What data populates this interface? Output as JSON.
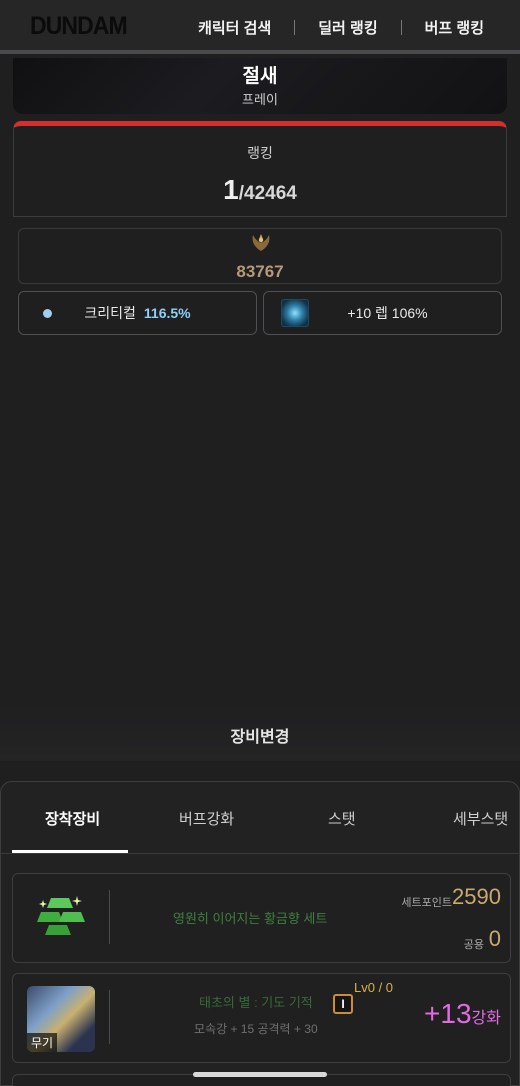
{
  "header": {
    "logo": "DUNDAM",
    "nav": [
      "캐릭터 검색",
      "딜러 랭킹",
      "버프 랭킹"
    ]
  },
  "character": {
    "name": "절새",
    "job": "프레이"
  },
  "ranking": {
    "label": "랭킹",
    "rank": "1",
    "total": "/42464"
  },
  "score": {
    "value": "83767",
    "emblem_icon": "laurel-emblem-icon"
  },
  "stats": {
    "crit_label": "크리티컬",
    "crit_value": "116.5%",
    "level_text": "+10 렙 106%",
    "level_icon": "skill-icon"
  },
  "change_equipment": "장비변경",
  "tabs": [
    "장착장비",
    "버프강화",
    "스탯",
    "세부스탯"
  ],
  "set_item": {
    "name": "영원히 이어지는 황금향 세트",
    "set_point_label": "세트포인트",
    "set_point_value": "2590",
    "common_label": "공용",
    "common_value": "0",
    "icon": "gold-bars-icon"
  },
  "weapon": {
    "tag": "무기",
    "name": "태초의 별 : 기도 기적",
    "tier": "I",
    "level": "Lv0 / 0",
    "stats": "모속강 + 15 공격력 + 30",
    "enhance_value": "+13",
    "enhance_unit": "강화"
  },
  "colors": {
    "accent_red": "#d2302f",
    "crit_blue": "#8fd0f5",
    "gold": "#c9aa6e",
    "enhance_pink": "#e36ae3"
  }
}
